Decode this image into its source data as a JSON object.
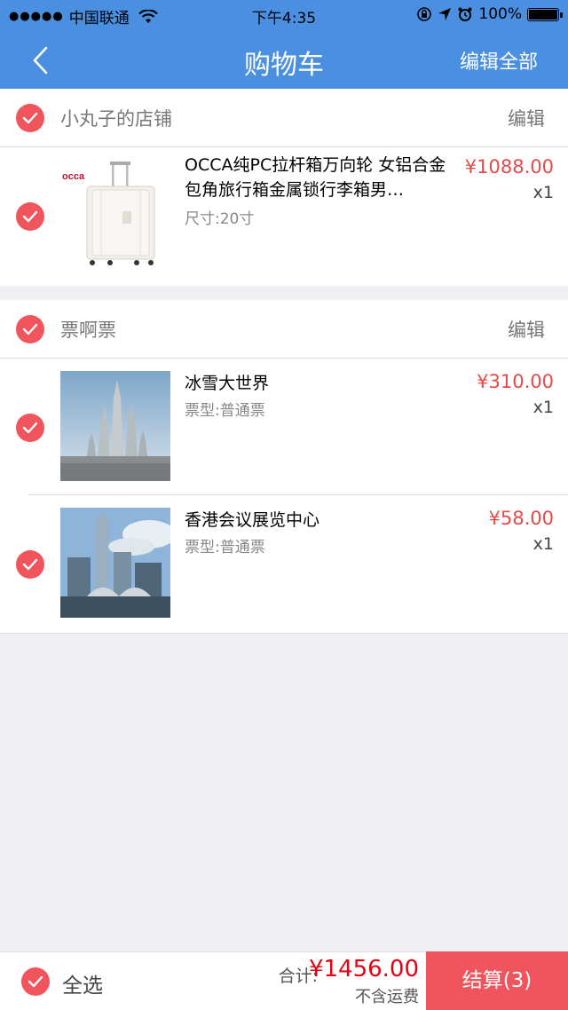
{
  "status": {
    "carrier": "中国联通",
    "time": "下午4:35",
    "battery": "100%"
  },
  "nav": {
    "title": "购物车",
    "edit_all": "编辑全部"
  },
  "shops": [
    {
      "name": "小丸子的店铺",
      "edit": "编辑",
      "items": [
        {
          "title": "OCCA纯PC拉杆箱万向轮 女铝合金包角旅行箱金属锁行李箱男…",
          "spec": "尺寸:20寸",
          "price": "¥1088.00",
          "qty": "x1",
          "brand": "occa"
        }
      ]
    },
    {
      "name": "票啊票",
      "edit": "编辑",
      "items": [
        {
          "title": "冰雪大世界",
          "spec": "票型:普通票",
          "price": "¥310.00",
          "qty": "x1"
        },
        {
          "title": "香港会议展览中心",
          "spec": "票型:普通票",
          "price": "¥58.00",
          "qty": "x1"
        }
      ]
    }
  ],
  "footer": {
    "select_all": "全选",
    "total_label": "合计:",
    "total": "¥1456.00",
    "freight": "不含运费",
    "checkout": "结算(3)"
  },
  "colors": {
    "nav": "#4a8fe0",
    "accent": "#f0545c",
    "price": "#e64a4a"
  }
}
